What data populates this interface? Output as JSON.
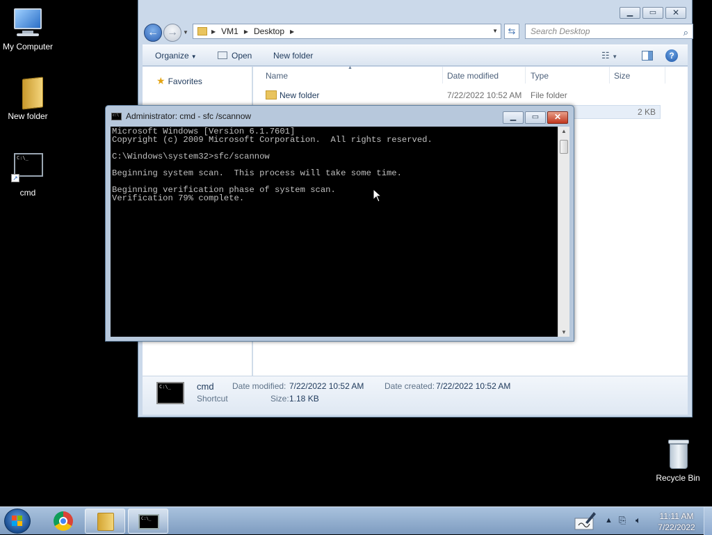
{
  "desktop": {
    "icons": [
      {
        "label": "My Computer"
      },
      {
        "label": "New folder"
      },
      {
        "label": "cmd"
      },
      {
        "label": "Recycle Bin"
      }
    ]
  },
  "explorer": {
    "breadcrumb": [
      "VM1",
      "Desktop"
    ],
    "search_placeholder": "Search Desktop",
    "toolbar": {
      "organize": "Organize",
      "open": "Open",
      "new_folder": "New folder"
    },
    "nav": {
      "favorites": "Favorites"
    },
    "columns": [
      "Name",
      "Date modified",
      "Type",
      "Size"
    ],
    "files": [
      {
        "name": "New folder",
        "modified": "7/22/2022 10:52 AM",
        "type": "File folder",
        "size": ""
      },
      {
        "name": "",
        "modified": "",
        "type": "",
        "size": "2 KB"
      }
    ],
    "details": {
      "name": "cmd",
      "kind": "Shortcut",
      "date_modified_label": "Date modified:",
      "date_modified": "7/22/2022 10:52 AM",
      "date_created_label": "Date created:",
      "date_created": "7/22/2022 10:52 AM",
      "size_label": "Size:",
      "size": "1.18 KB"
    }
  },
  "cmd": {
    "title": "Administrator: cmd - sfc /scannow",
    "lines": [
      "Microsoft Windows [Version 6.1.7601]",
      "Copyright (c) 2009 Microsoft Corporation.  All rights reserved.",
      "",
      "C:\\Windows\\system32>sfc/scannow",
      "",
      "Beginning system scan.  This process will take some time.",
      "",
      "Beginning verification phase of system scan.",
      "Verification 79% complete."
    ]
  },
  "taskbar": {
    "items": [
      "start",
      "chrome",
      "windows-explorer",
      "cmd"
    ],
    "clock_time": "11:11 AM",
    "clock_date": "7/22/2022"
  },
  "colors": {
    "desktop_bg": "#000000",
    "taskbar": "#8fabd0",
    "explorer_frame": "#cbd9ea"
  }
}
